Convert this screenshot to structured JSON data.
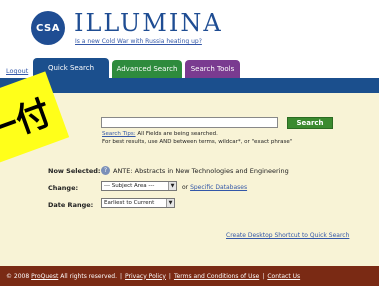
{
  "header": {
    "logo_text": "CSA",
    "brand": "ILLUMINA",
    "tagline": "Is a new Cold War with Russia heating up?"
  },
  "nav": {
    "logout": "Logout",
    "tabs": [
      {
        "label": "Quick Search",
        "color": "#1b4f8d"
      },
      {
        "label": "Advanced Search",
        "color": "#2e8b3d"
      },
      {
        "label": "Search Tools",
        "color": "#7a3b90"
      }
    ]
  },
  "search": {
    "input_value": "",
    "button_label": "Search",
    "tips_link": "Search Tips:",
    "tips_text": " All Fields are being searched.",
    "tips_line2": "For best results, use AND between terms, wildcar*, or \"exact phrase\""
  },
  "form": {
    "now_selected_label": "Now Selected:",
    "now_selected_value": "ANTE: Abstracts in New Technologies and Engineering",
    "change_label": "Change:",
    "subject_area_value": "--- Subject Area ---",
    "or_text": "or",
    "specific_databases_link": "Specific Databases",
    "date_range_label": "Date Range:",
    "date_range_value": "Earliest to Current"
  },
  "shortcut_link": "Create Desktop Shortcut to Quick Search",
  "footer": {
    "copyright_prefix": "© 2008",
    "proquest": "ProQuest",
    "rights": "All rights reserved.",
    "privacy": "Privacy Policy",
    "terms": "Terms and Conditions of Use",
    "contact": "Contact Us"
  },
  "sticker": {
    "text": "一付",
    "color": "#ffff1a"
  }
}
